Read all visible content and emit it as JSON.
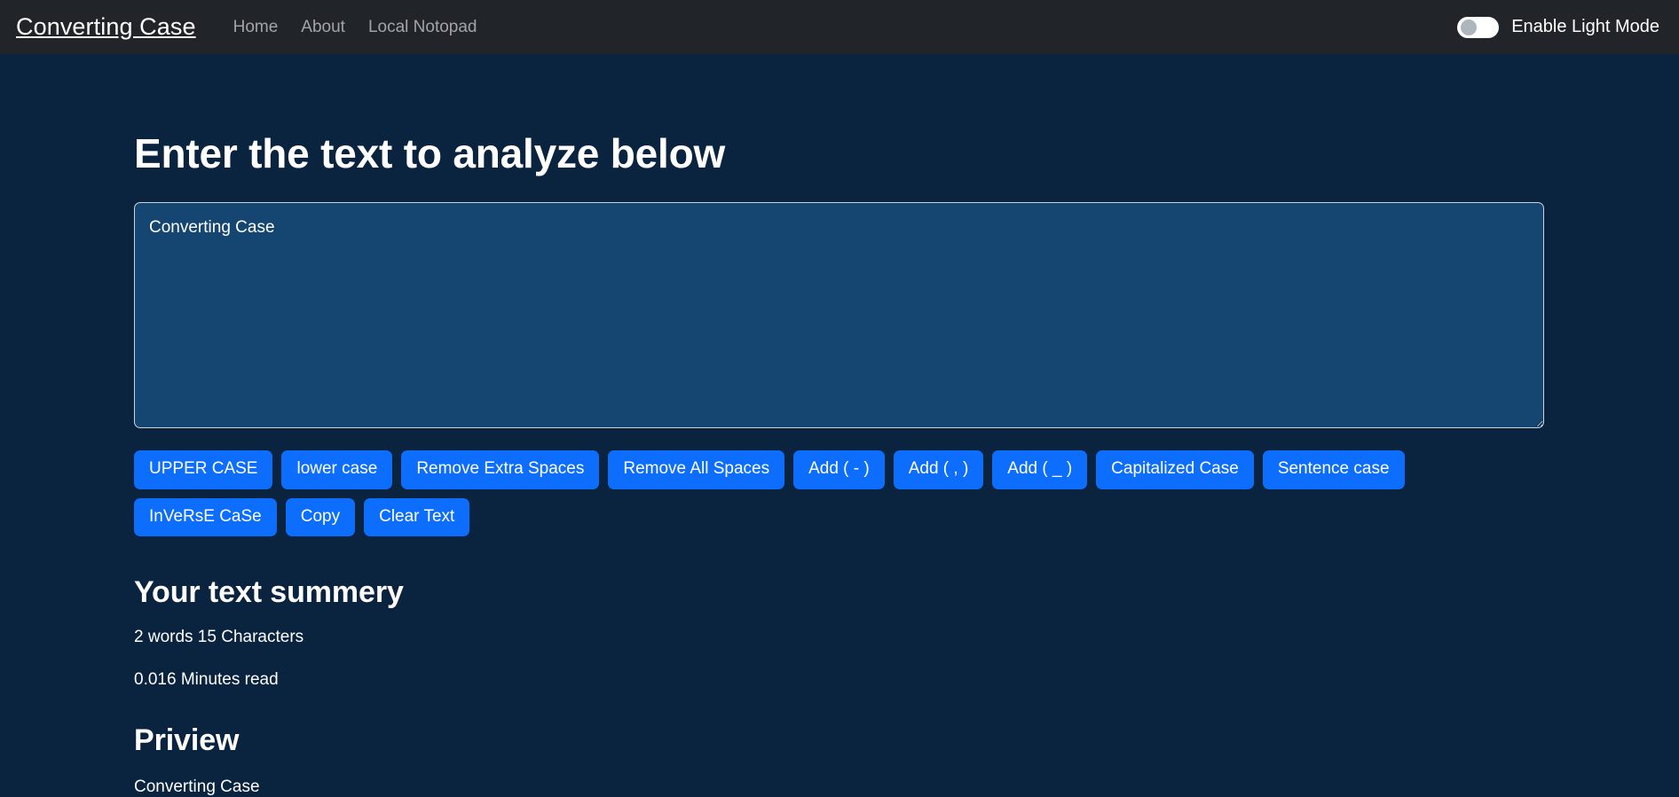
{
  "navbar": {
    "brand": "Converting Case",
    "links": [
      {
        "label": "Home"
      },
      {
        "label": "About"
      },
      {
        "label": "Local Notopad"
      }
    ],
    "theme_toggle": {
      "label": "Enable Light Mode",
      "state": "off"
    },
    "background_color": "#212529"
  },
  "main": {
    "heading": "Enter the text to analyze below",
    "textarea": {
      "value": "Converting Case",
      "placeholder": "",
      "background_color": "#154571",
      "border_color": "#ced4da"
    },
    "buttons": [
      {
        "label": "UPPER CASE"
      },
      {
        "label": "lower case"
      },
      {
        "label": "Remove Extra Spaces"
      },
      {
        "label": "Remove All Spaces"
      },
      {
        "label": "Add ( - )"
      },
      {
        "label": "Add ( , )"
      },
      {
        "label": "Add ( _ )"
      },
      {
        "label": "Capitalized Case"
      },
      {
        "label": "Sentence case"
      },
      {
        "label": "InVeRsE CaSe"
      },
      {
        "label": "Copy"
      },
      {
        "label": "Clear Text"
      }
    ],
    "button_color": "#0d6efd",
    "summary": {
      "title": "Your text summery",
      "counts": "2 words 15 Characters",
      "read_time": "0.016 Minutes read"
    },
    "preview": {
      "title": "Priview",
      "text": "Converting Case"
    }
  },
  "page": {
    "background_color": "#0a2440"
  }
}
